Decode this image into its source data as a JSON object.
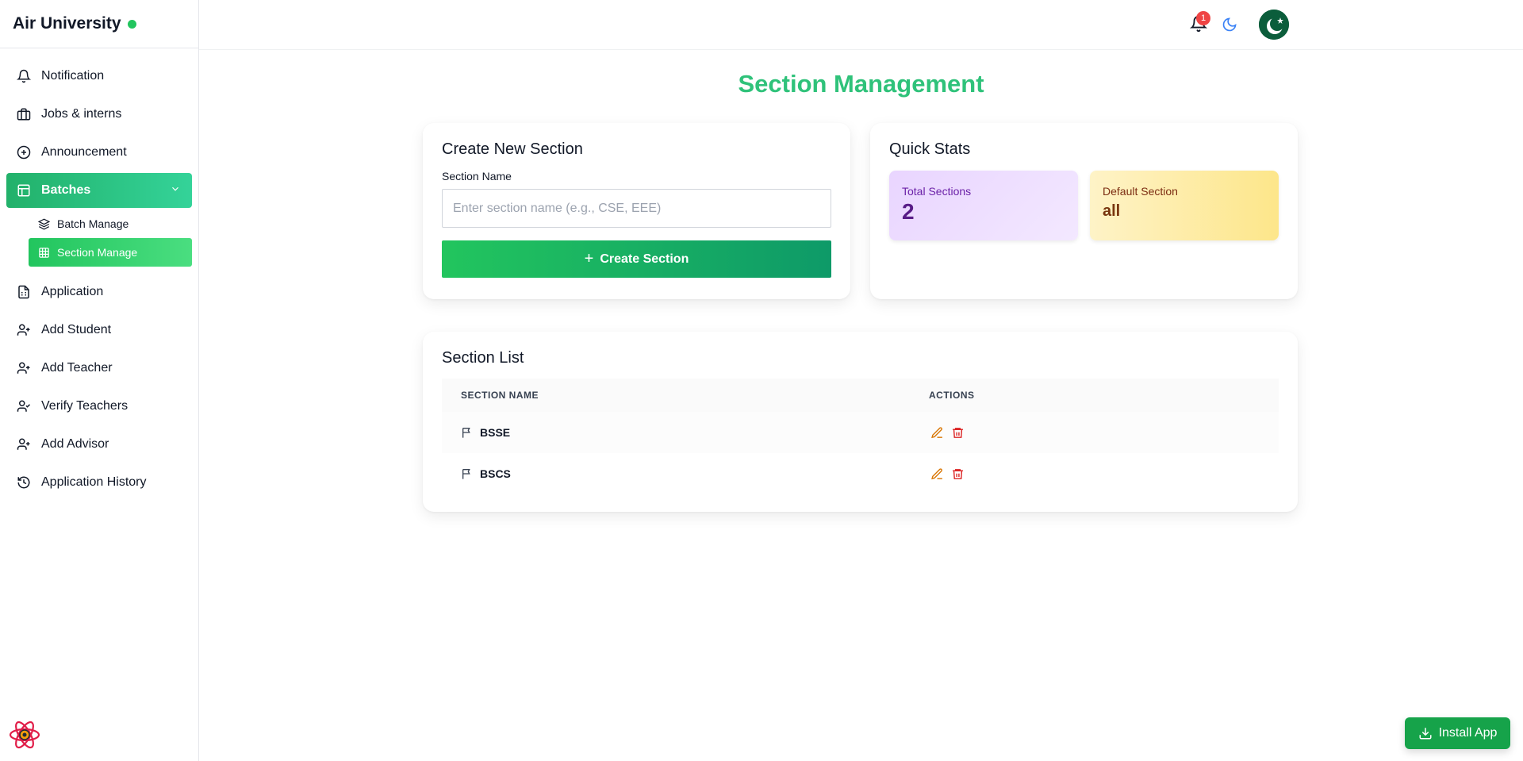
{
  "app": {
    "title": "Air University",
    "status_color": "#22c55e"
  },
  "sidebar": {
    "items": [
      {
        "label": "Notification",
        "icon": "bell-icon"
      },
      {
        "label": "Jobs & interns",
        "icon": "briefcase-icon"
      },
      {
        "label": "Announcement",
        "icon": "plus-circle-icon"
      },
      {
        "label": "Batches",
        "icon": "layout-icon",
        "expanded": true
      },
      {
        "label": "Application",
        "icon": "file-icon"
      },
      {
        "label": "Add Student",
        "icon": "user-plus-icon"
      },
      {
        "label": "Add Teacher",
        "icon": "user-plus-icon"
      },
      {
        "label": "Verify Teachers",
        "icon": "user-check-icon"
      },
      {
        "label": "Add Advisor",
        "icon": "user-plus-icon"
      },
      {
        "label": "Application History",
        "icon": "history-icon"
      }
    ],
    "subitems": [
      {
        "label": "Batch Manage",
        "icon": "layers-icon"
      },
      {
        "label": "Section Manage",
        "icon": "grid-icon",
        "active": true
      }
    ]
  },
  "header": {
    "notification_count": "1"
  },
  "main": {
    "title": "Section Management",
    "create": {
      "heading": "Create New Section",
      "field_label": "Section Name",
      "placeholder": "Enter section name (e.g., CSE, EEE)",
      "button_label": "Create Section"
    },
    "stats": {
      "heading": "Quick Stats",
      "total_label": "Total Sections",
      "total_value": "2",
      "default_label": "Default Section",
      "default_value": "all"
    },
    "list": {
      "heading": "Section List",
      "col_name": "SECTION NAME",
      "col_actions": "ACTIONS",
      "rows": [
        {
          "name": "BSSE"
        },
        {
          "name": "BSCS"
        }
      ]
    }
  },
  "install": {
    "label": "Install App"
  },
  "colors": {
    "accent": "#2fc27a",
    "danger": "#dc2626",
    "edit": "#d97706"
  }
}
